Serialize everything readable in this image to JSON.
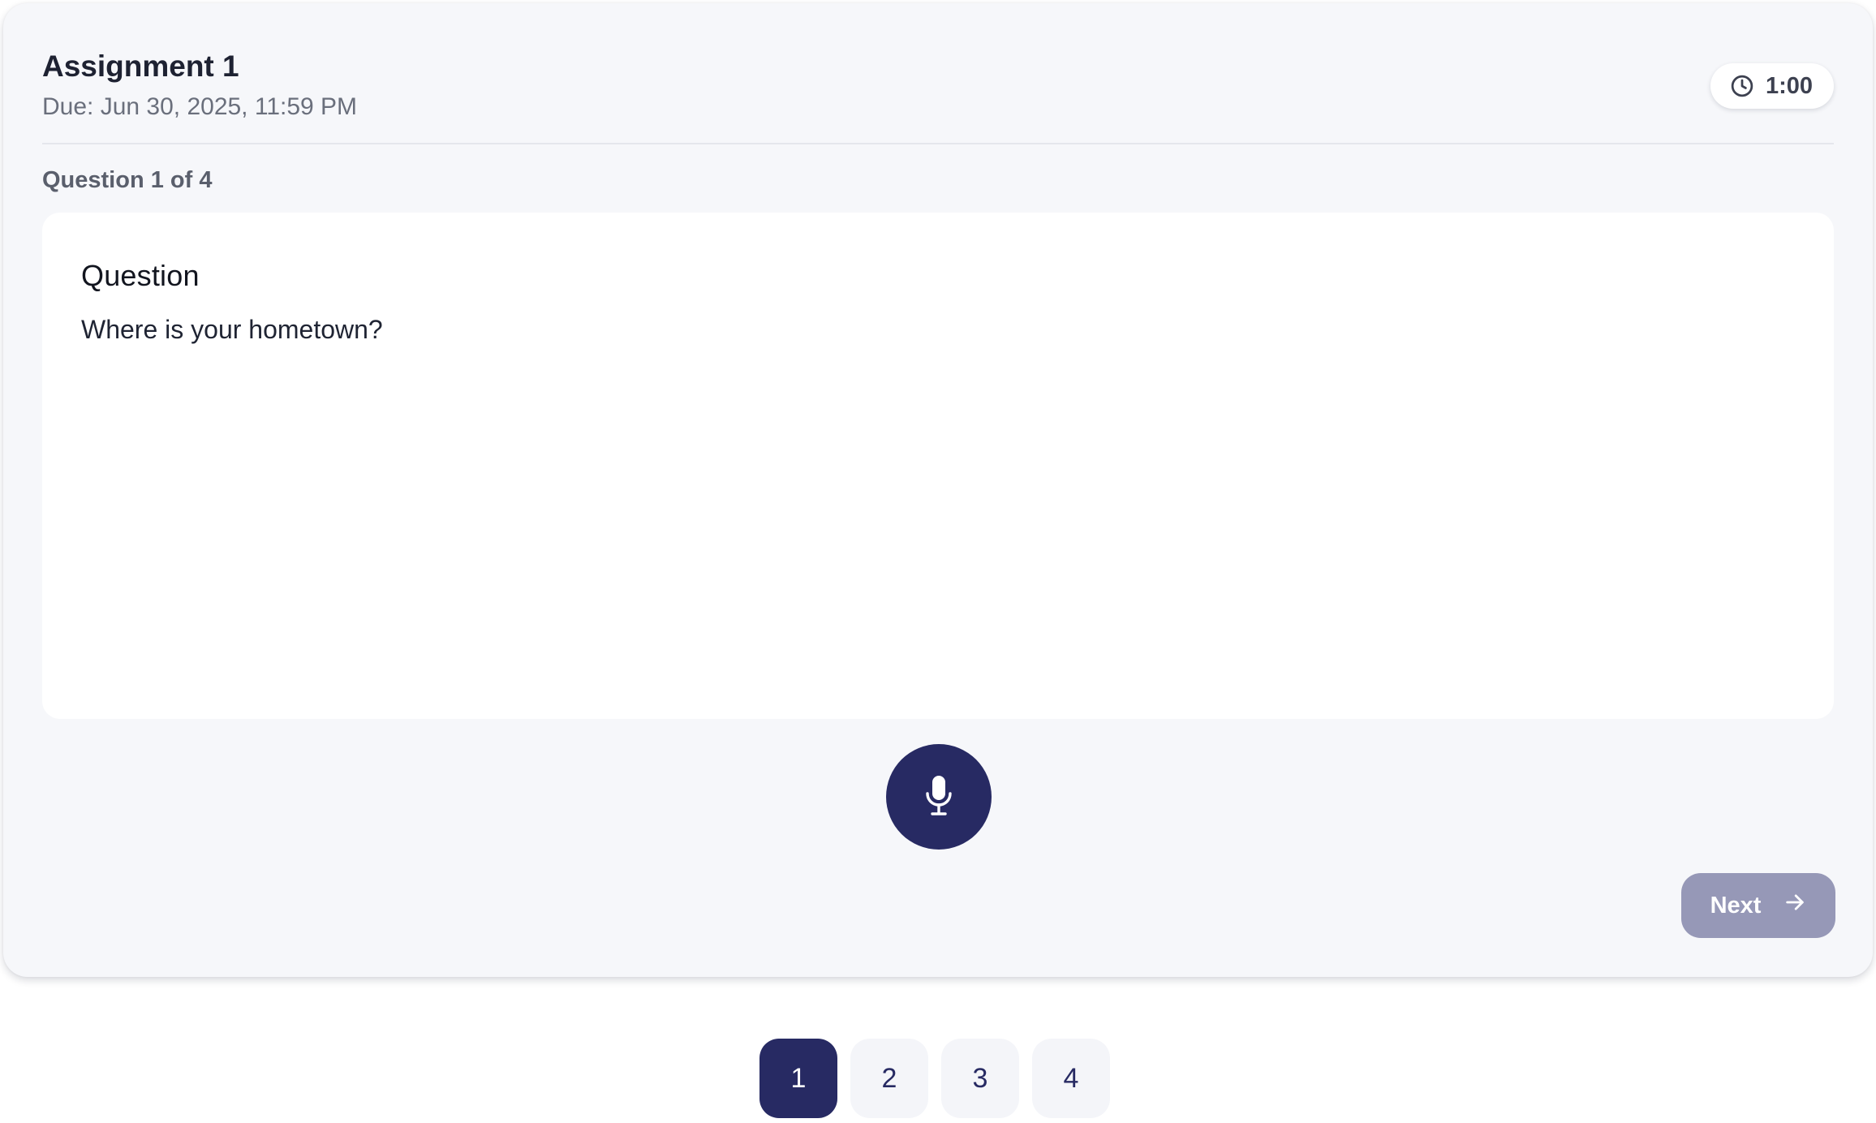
{
  "assignment": {
    "title": "Assignment 1",
    "due": "Due: Jun 30, 2025, 11:59 PM"
  },
  "timer": {
    "icon": "clock-icon",
    "value": "1:00"
  },
  "progress": {
    "label": "Question 1 of 4"
  },
  "question": {
    "heading": "Question",
    "text": "Where is your hometown?"
  },
  "record": {
    "icon": "microphone-icon"
  },
  "navigation": {
    "next_label": "Next",
    "next_icon": "arrow-right-icon"
  },
  "pages": [
    {
      "label": "1",
      "active": true
    },
    {
      "label": "2",
      "active": false
    },
    {
      "label": "3",
      "active": false
    },
    {
      "label": "4",
      "active": false
    }
  ],
  "colors": {
    "primary": "#272a63",
    "next_button": "#9698b7",
    "card_background": "#f6f7fa"
  }
}
